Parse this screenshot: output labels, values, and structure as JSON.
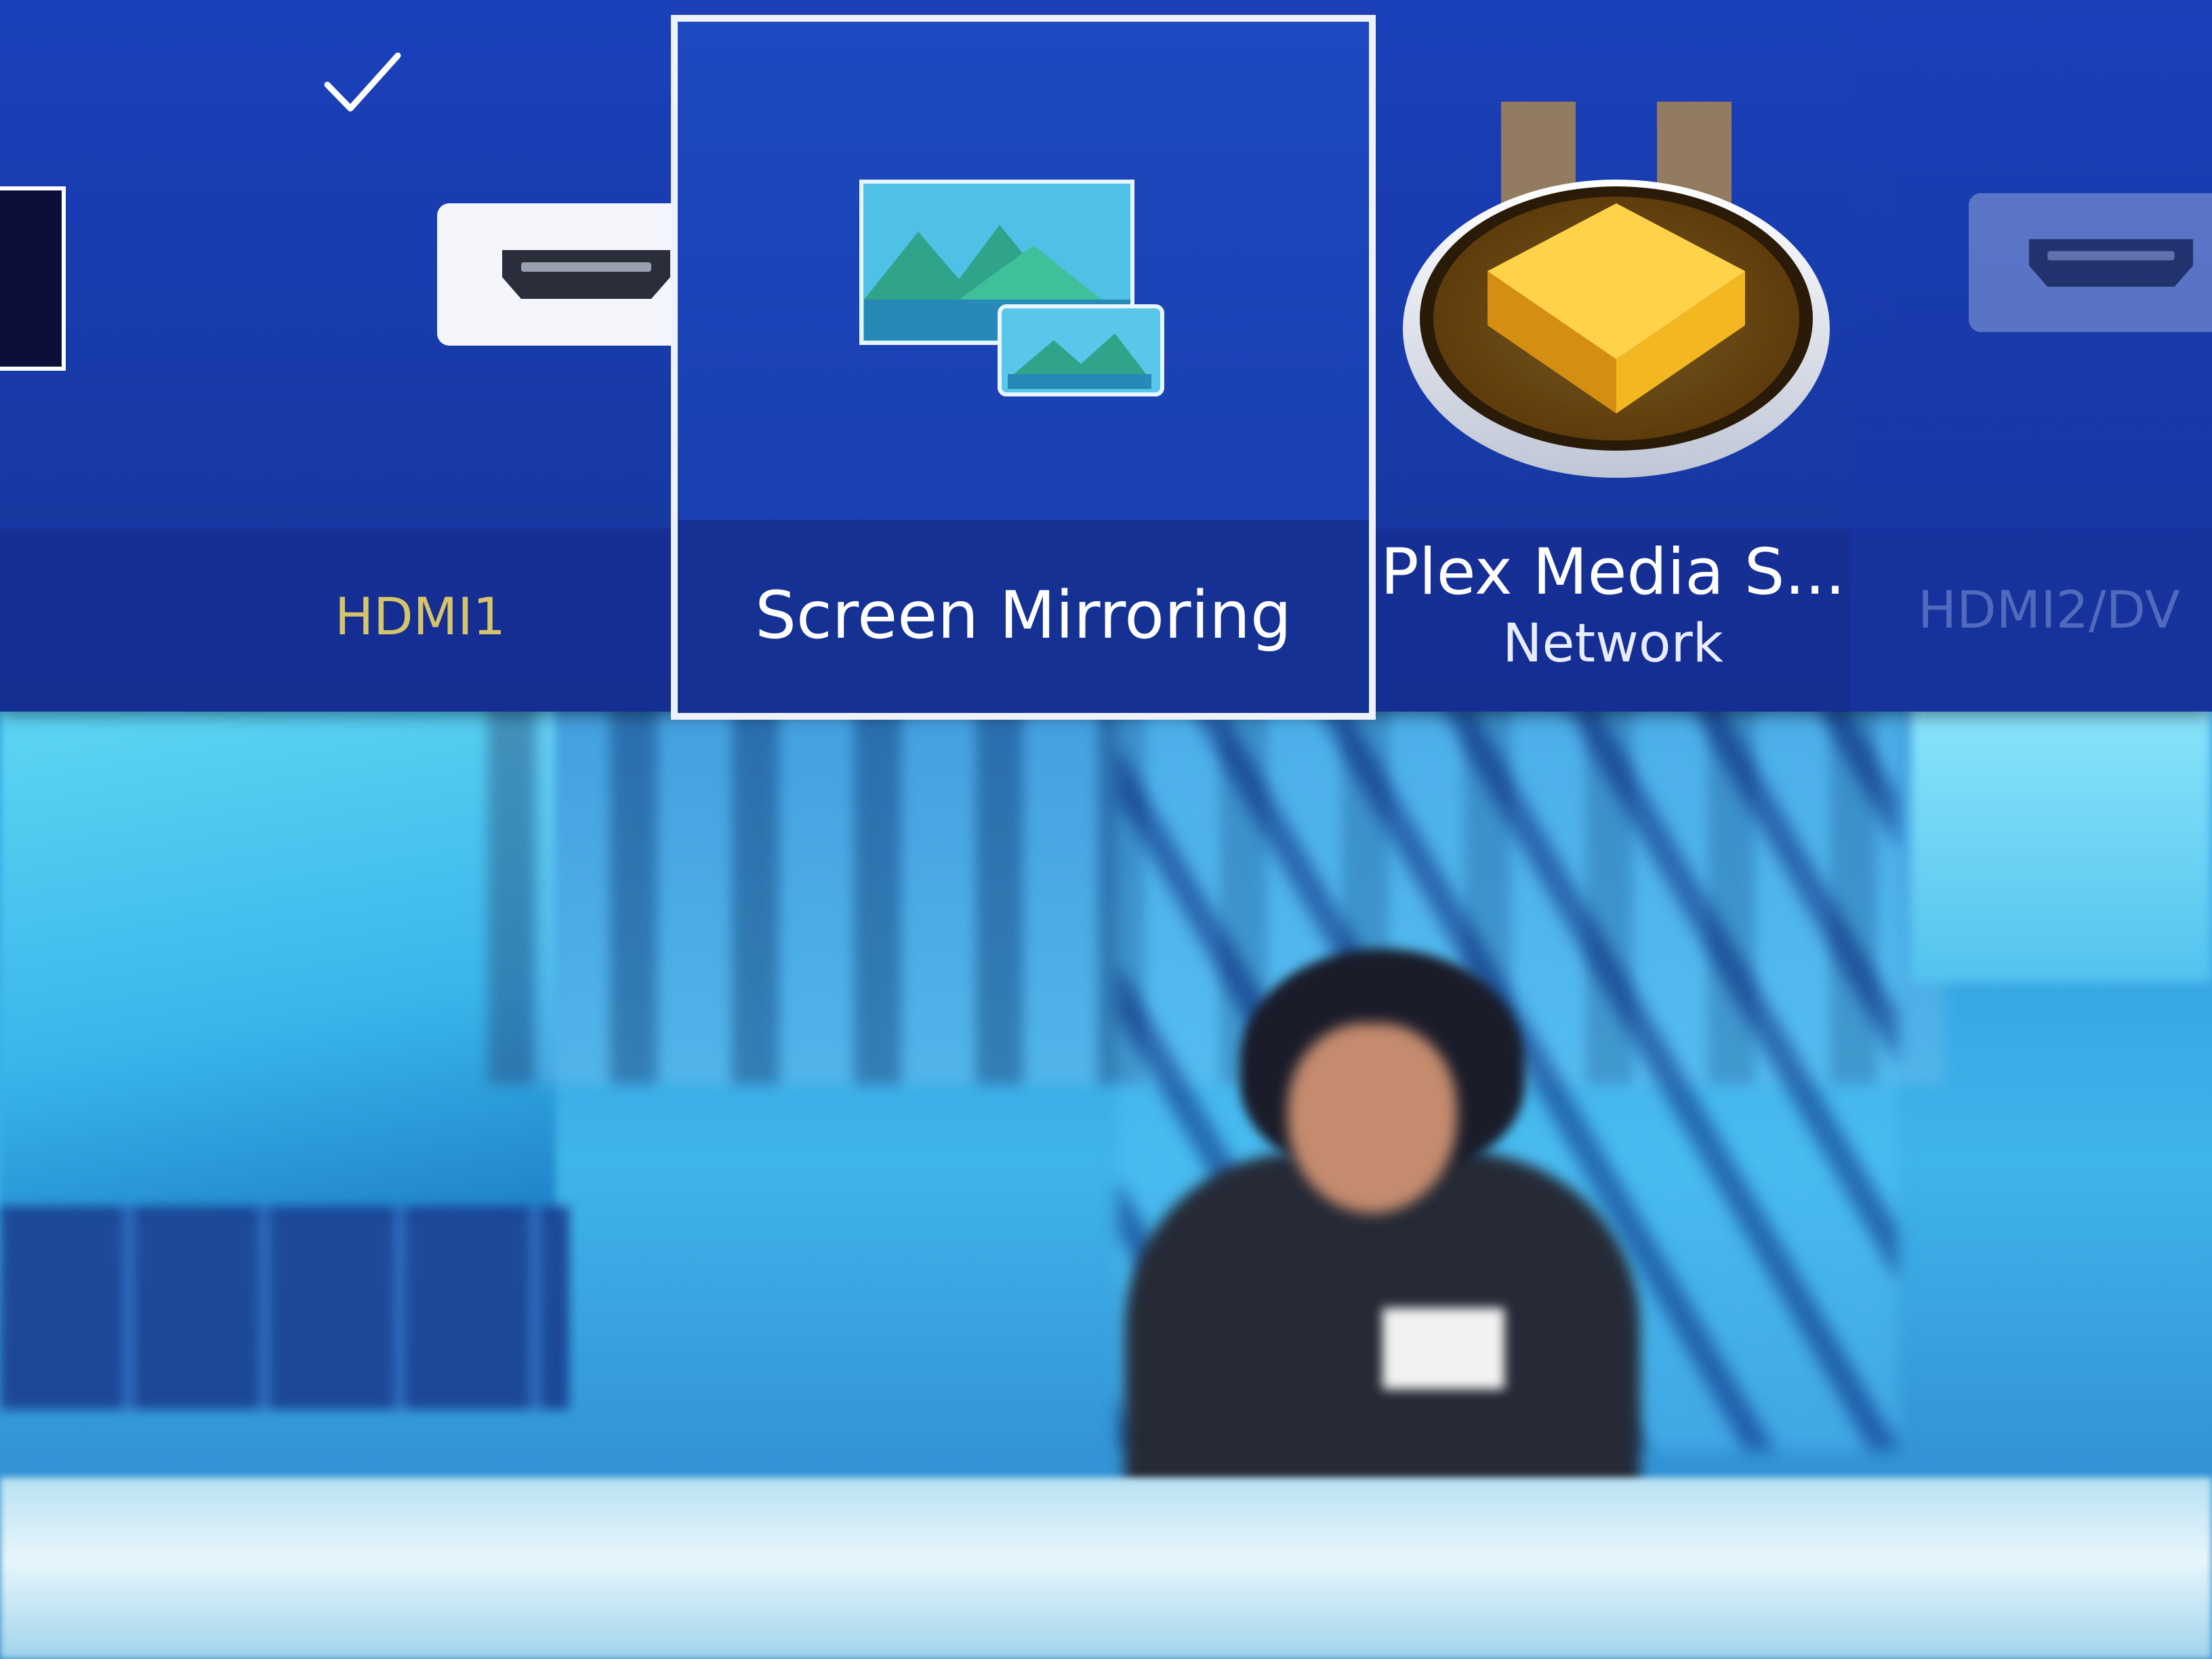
{
  "source_bar": {
    "previous_source": {
      "icon": "tv-screen-icon"
    },
    "hdmi1": {
      "label": "HDMI1",
      "icon": "hdmi-port-icon",
      "selected_mark": "check-icon",
      "label_color": "#d6c46a"
    },
    "screen_mirroring": {
      "label": "Screen Mirroring",
      "icon": "screen-mirroring-icon",
      "focused": true
    },
    "plex": {
      "label": "Plex Media S...",
      "sublabel": "Network",
      "icon": "plex-media-server-icon"
    },
    "hdmi2": {
      "label": "HDMI2/DV",
      "icon": "hdmi-port-icon"
    }
  },
  "background": {
    "content": "tv-broadcast"
  },
  "colors": {
    "bar_blue": "#1a3fb0",
    "focus_border": "#eef2ff",
    "active_label": "#d6c46a",
    "plex_gold": "#f3b722"
  }
}
